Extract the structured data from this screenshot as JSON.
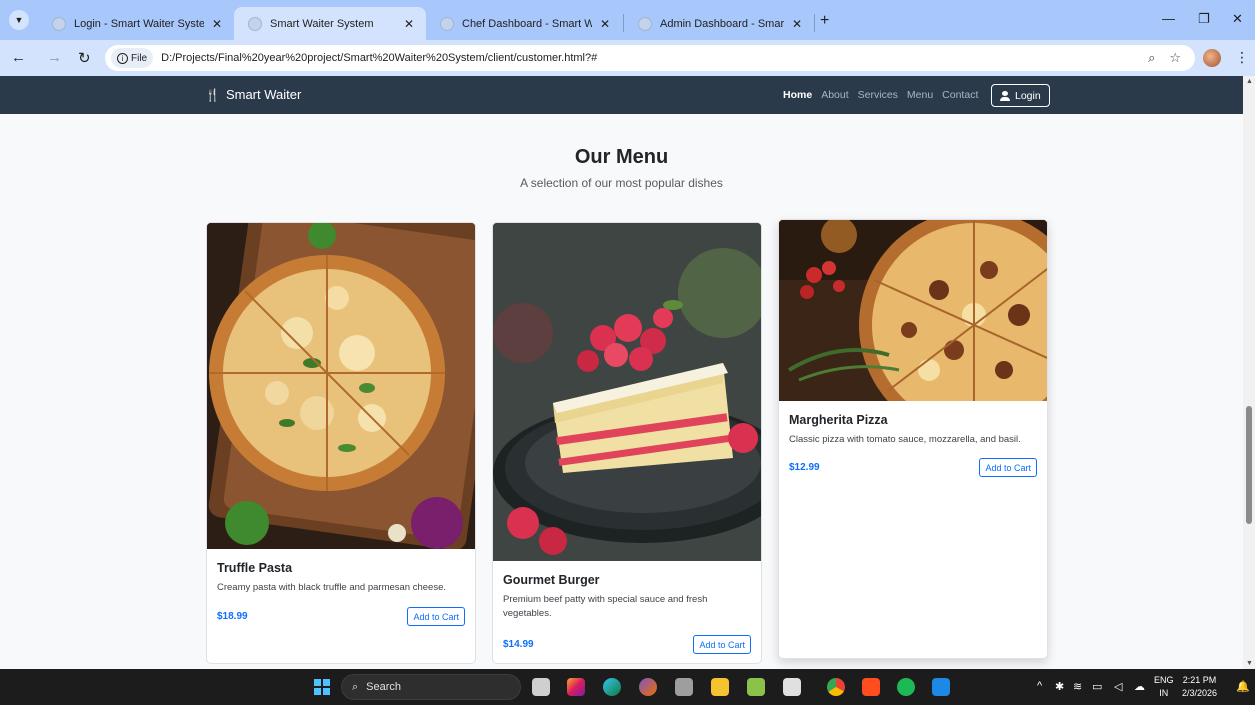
{
  "browser": {
    "tabs": [
      {
        "title": "Login - Smart Waiter System",
        "active": false
      },
      {
        "title": "Smart Waiter System",
        "active": true
      },
      {
        "title": "Chef Dashboard - Smart Waiter",
        "active": false
      },
      {
        "title": "Admin Dashboard - Smart Waiter",
        "active": false
      }
    ],
    "address": {
      "chip_label": "File",
      "url": "D:/Projects/Final%20year%20project/Smart%20Waiter%20System/client/customer.html?#"
    }
  },
  "site": {
    "brand": "Smart Waiter",
    "nav": [
      "Home",
      "About",
      "Services",
      "Menu",
      "Contact"
    ],
    "login_label": "Login"
  },
  "menu_section": {
    "title": "Our Menu",
    "subtitle": "A selection of our most popular dishes",
    "items": [
      {
        "name": "Truffle Pasta",
        "description": "Creamy pasta with black truffle and parmesan cheese.",
        "price": "$18.99",
        "button": "Add to Cart"
      },
      {
        "name": "Gourmet Burger",
        "description": "Premium beef patty with special sauce and fresh vegetables.",
        "price": "$14.99",
        "button": "Add to Cart"
      },
      {
        "name": "Margherita Pizza",
        "description": "Classic pizza with tomato sauce, mozzarella, and basil.",
        "price": "$12.99",
        "button": "Add to Cart"
      }
    ]
  },
  "taskbar": {
    "search_label": "Search",
    "lang_top": "ENG",
    "lang_bottom": "IN",
    "time": "2:21 PM",
    "date": "2/3/2026"
  },
  "colors": {
    "navbar": "#2b3a4b",
    "accent": "#0d6efd",
    "tabbar": "#a8c7fa"
  }
}
